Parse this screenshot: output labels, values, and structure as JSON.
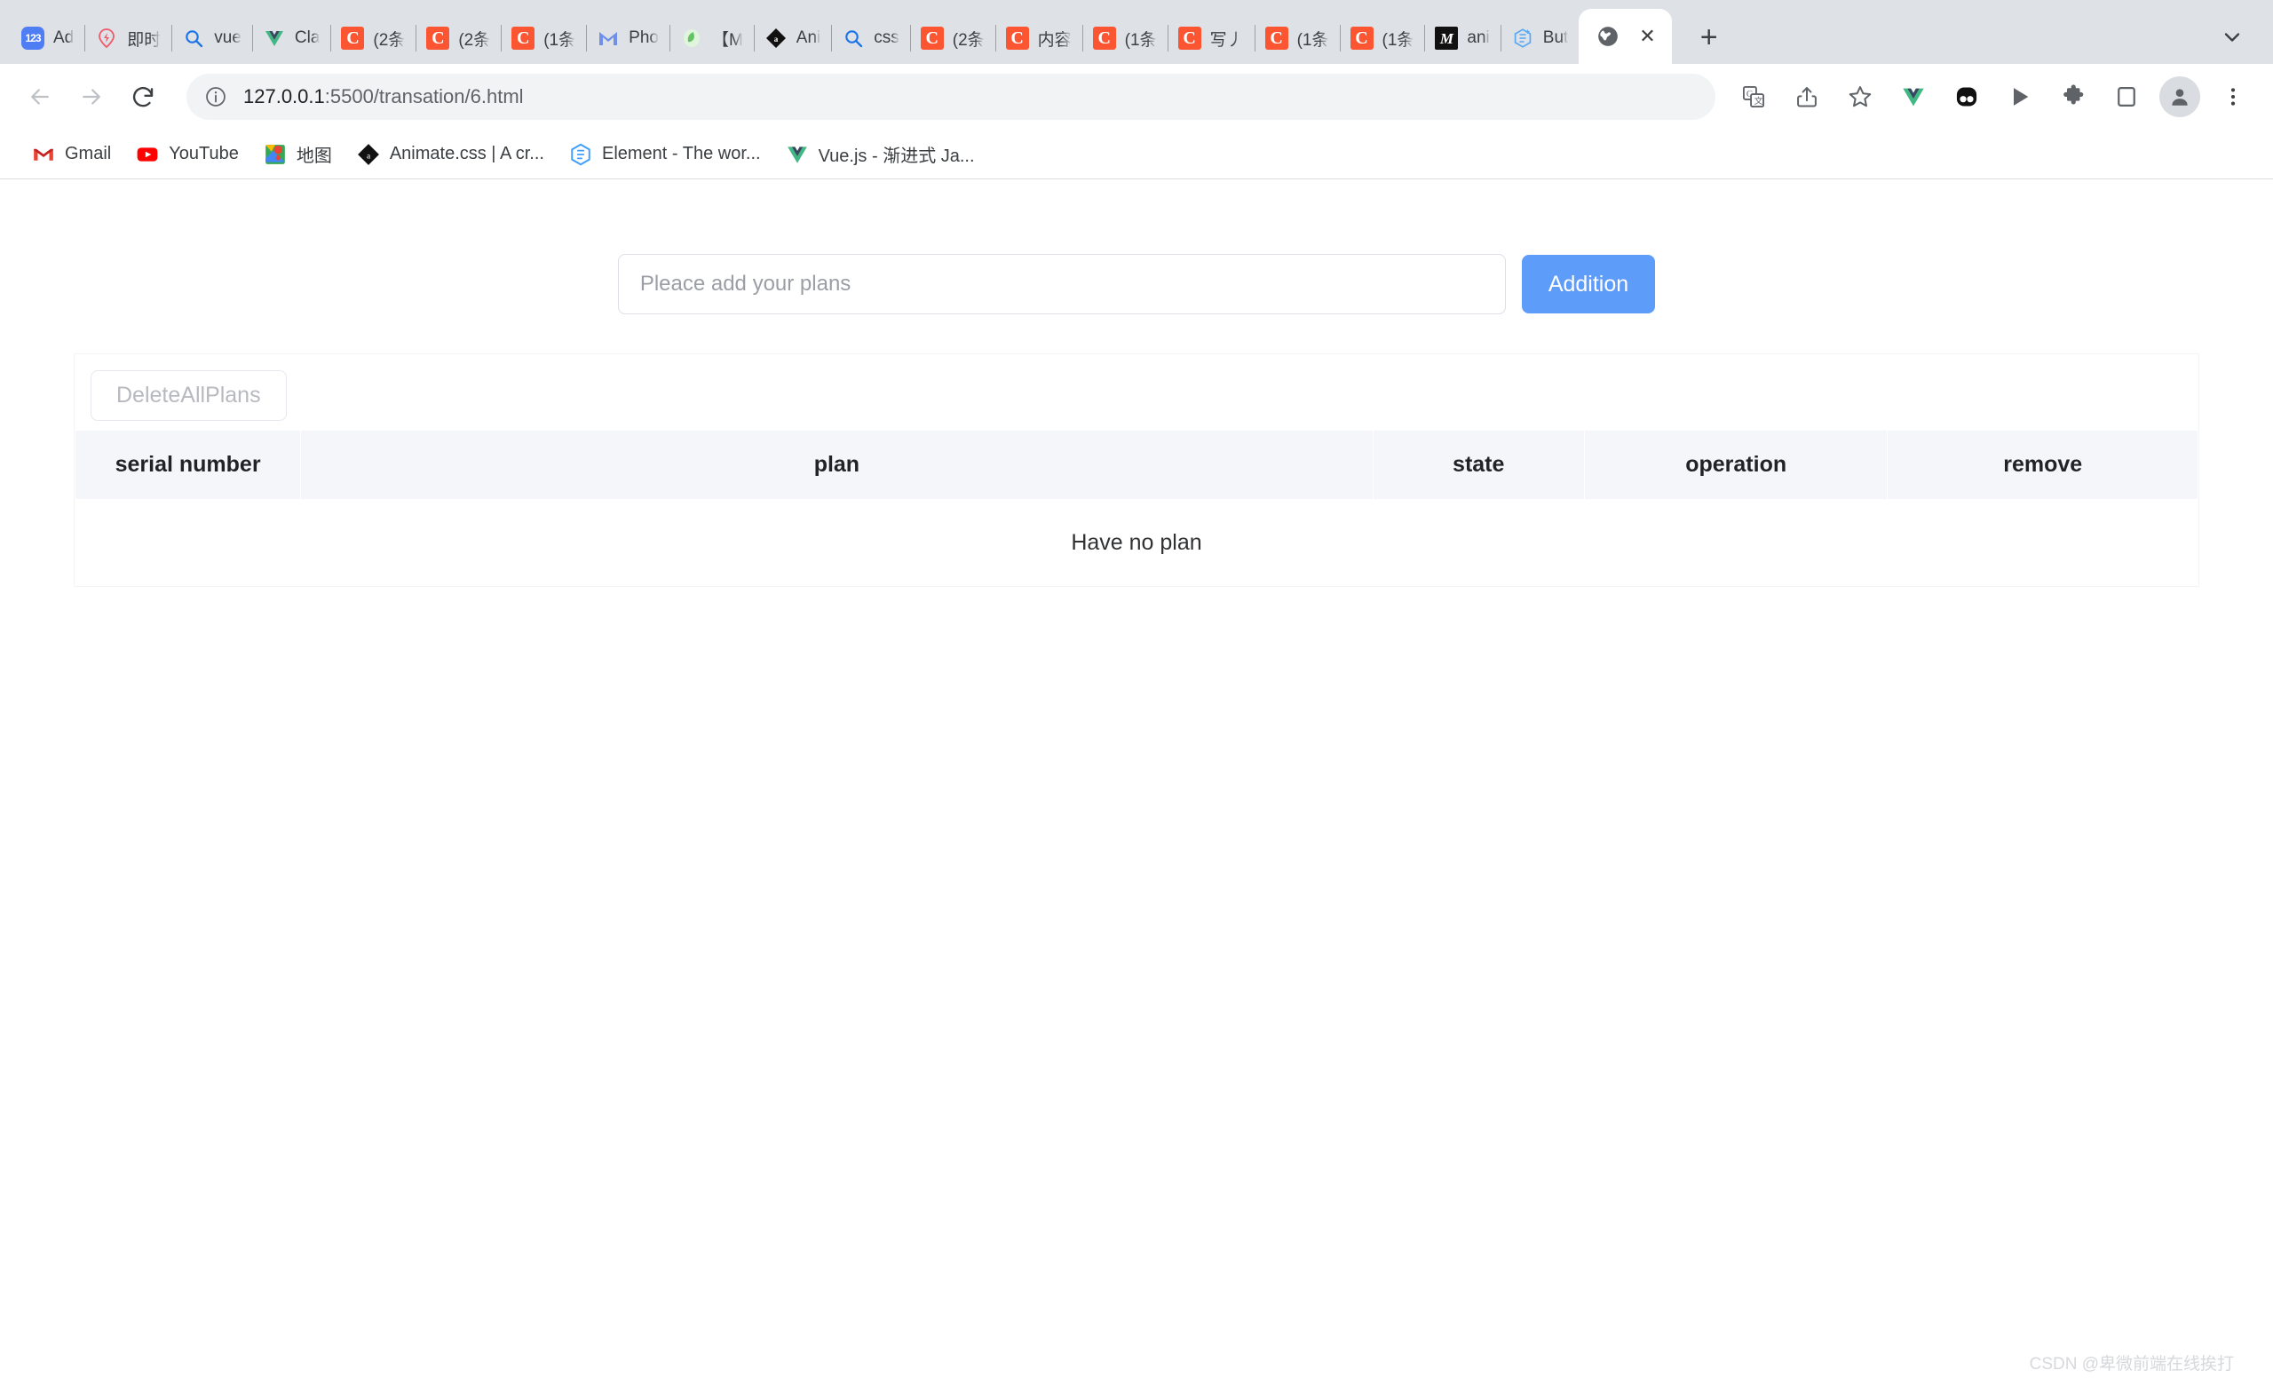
{
  "browser": {
    "tabs": [
      {
        "title": "Ad",
        "favicon": "123-icon",
        "type": "123"
      },
      {
        "title": "即时",
        "favicon": "lightning-pin-icon",
        "type": "lightning"
      },
      {
        "title": "vue",
        "favicon": "search-icon",
        "type": "search"
      },
      {
        "title": "Cla",
        "favicon": "vue-icon",
        "type": "vue"
      },
      {
        "title": "(2条",
        "favicon": "csdn-icon",
        "type": "csdn"
      },
      {
        "title": "(2条",
        "favicon": "csdn-icon",
        "type": "csdn"
      },
      {
        "title": "(1条",
        "favicon": "csdn-icon",
        "type": "csdn"
      },
      {
        "title": "Pho",
        "favicon": "gmail-m-icon",
        "type": "m"
      },
      {
        "title": "【M",
        "favicon": "green-leaf-icon",
        "type": "leaf"
      },
      {
        "title": "Ani",
        "favicon": "animate-diamond-icon",
        "type": "diamond"
      },
      {
        "title": "css",
        "favicon": "search-icon",
        "type": "search"
      },
      {
        "title": "(2条",
        "favicon": "csdn-icon",
        "type": "csdn"
      },
      {
        "title": "内容",
        "favicon": "csdn-icon",
        "type": "csdn"
      },
      {
        "title": "(1条",
        "favicon": "csdn-icon",
        "type": "csdn"
      },
      {
        "title": "写丿",
        "favicon": "csdn-icon",
        "type": "csdn"
      },
      {
        "title": "(1条",
        "favicon": "csdn-icon",
        "type": "csdn"
      },
      {
        "title": "(1条",
        "favicon": "csdn-icon",
        "type": "csdn"
      },
      {
        "title": "ani",
        "favicon": "markdown-icon",
        "type": "dark"
      },
      {
        "title": "But",
        "favicon": "element-ui-icon",
        "type": "element"
      }
    ],
    "active_tab": {
      "title": "",
      "favicon": "globe-icon",
      "close_label": "✕"
    },
    "new_tab_label": "+",
    "nav": {
      "back_label": "←",
      "forward_label": "→",
      "reload_label": "⟳"
    },
    "omnibox": {
      "info_icon": "info-circle-icon",
      "url_host": "127.0.0.1",
      "url_rest": ":5500/transation/6.html",
      "url_full": "127.0.0.1:5500/transation/6.html"
    },
    "toolbar_icons": [
      "translate-icon",
      "share-icon",
      "bookmark-star-icon",
      "vue-devtools-icon",
      "eyes-extension-icon",
      "play-icon",
      "extensions-puzzle-icon",
      "side-panel-icon",
      "profile-avatar-icon",
      "three-dot-menu-icon"
    ],
    "bookmarks": [
      {
        "label": "Gmail",
        "icon": "gmail-icon"
      },
      {
        "label": "YouTube",
        "icon": "youtube-icon"
      },
      {
        "label": "地图",
        "icon": "google-maps-icon"
      },
      {
        "label": "Animate.css | A cr...",
        "icon": "animate-css-icon"
      },
      {
        "label": "Element - The wor...",
        "icon": "element-ui-icon"
      },
      {
        "label": "Vue.js - 渐进式 Ja...",
        "icon": "vue-icon"
      }
    ]
  },
  "page": {
    "add_form": {
      "input_value": "",
      "input_placeholder": "Pleace add your plans",
      "submit_label": "Addition"
    },
    "delete_all_label": "DeleteAllPlans",
    "table": {
      "headers": [
        "serial number",
        "plan",
        "state",
        "operation",
        "remove"
      ],
      "rows": [],
      "empty_message": "Have no plan"
    },
    "watermark": "CSDN @卑微前端在线挨打",
    "colors": {
      "accent_blue": "#5d9cf8",
      "header_bg": "#f5f6fa",
      "border": "#dcdfe6",
      "disabled_text": "#b7b9bf"
    }
  }
}
